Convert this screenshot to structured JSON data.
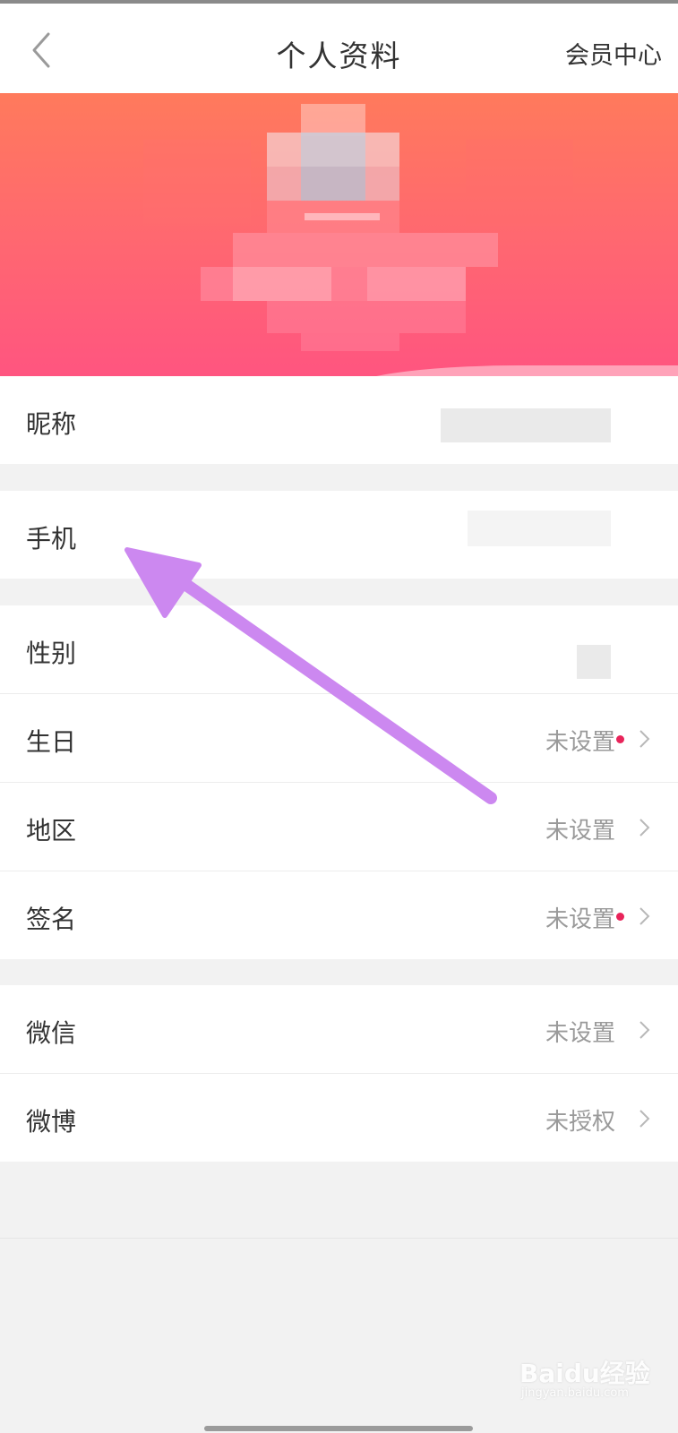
{
  "header": {
    "title": "个人资料",
    "right_link": "会员中心"
  },
  "profile_rows": {
    "nickname": {
      "label": "昵称"
    },
    "phone": {
      "label": "手机"
    },
    "gender": {
      "label": "性别"
    },
    "birthday": {
      "label": "生日",
      "value": "未设置",
      "has_dot": true
    },
    "region": {
      "label": "地区",
      "value": "未设置",
      "has_dot": false
    },
    "signature": {
      "label": "签名",
      "value": "未设置",
      "has_dot": true
    }
  },
  "social_rows": {
    "wechat": {
      "label": "微信",
      "value": "未设置"
    },
    "weibo": {
      "label": "微博",
      "value": "未授权"
    }
  },
  "watermark": {
    "brand": "Baidu经验",
    "domain": "jingyan.baidu.com"
  },
  "colors": {
    "banner_top": "#ff7a5c",
    "banner_bottom": "#ff5580",
    "notice_dot": "#e8245a",
    "annotation_arrow": "#cc88f0",
    "page_bg": "#f2f2f2"
  },
  "icons": [
    "back-chevron-icon",
    "chevron-right-icon",
    "annotation-arrow-icon"
  ]
}
